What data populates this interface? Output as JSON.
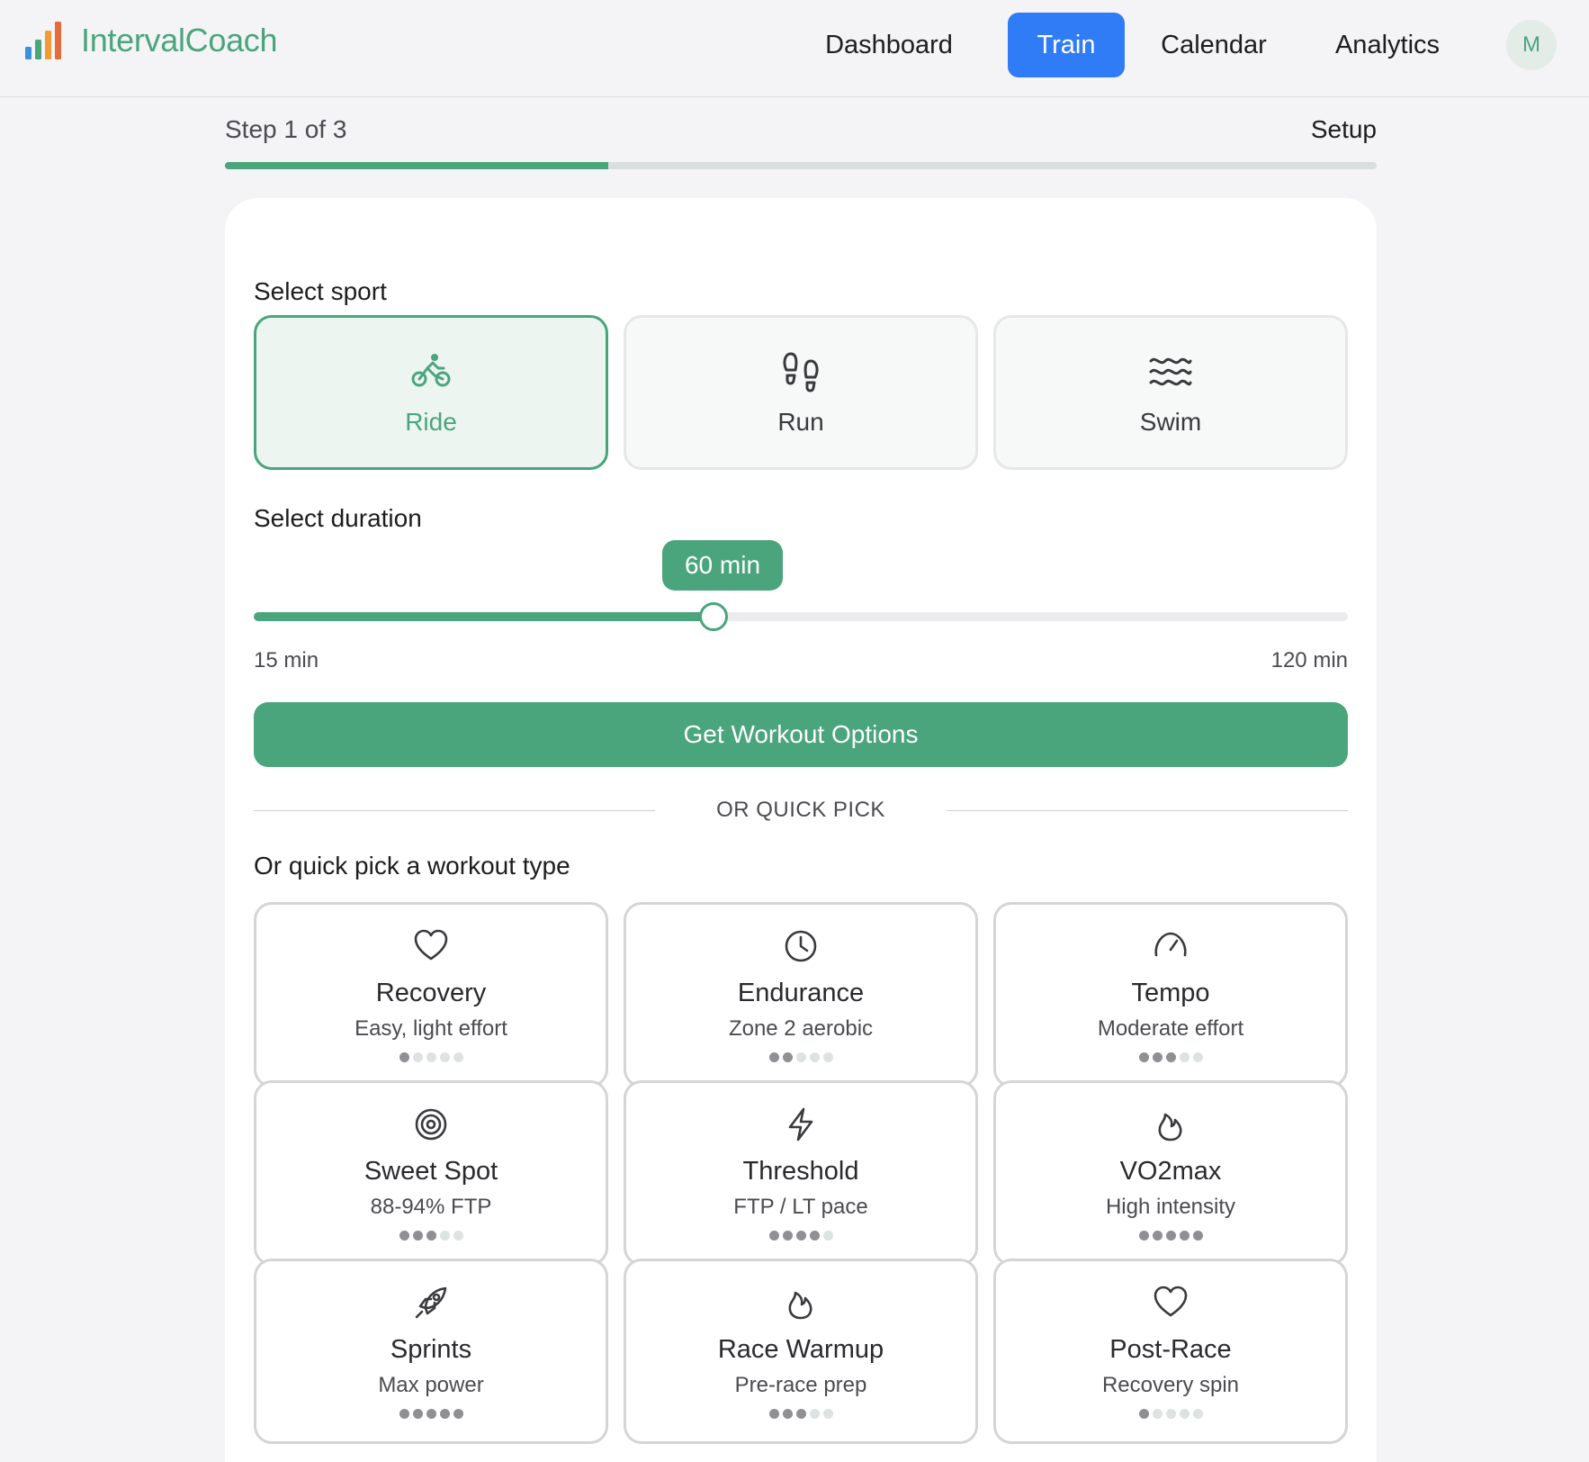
{
  "app": {
    "name": "IntervalCoach"
  },
  "nav": {
    "items": [
      {
        "label": "Dashboard",
        "active": false
      },
      {
        "label": "Train",
        "active": true
      },
      {
        "label": "Calendar",
        "active": false
      },
      {
        "label": "Analytics",
        "active": false
      }
    ],
    "avatar_initial": "M"
  },
  "progress": {
    "step_label": "Step 1 of 3",
    "step_name": "Setup",
    "fraction": 0.333
  },
  "sport_section": {
    "label": "Select sport",
    "options": [
      {
        "label": "Ride",
        "icon": "bike-icon",
        "selected": true
      },
      {
        "label": "Run",
        "icon": "footprints-icon",
        "selected": false
      },
      {
        "label": "Swim",
        "icon": "waves-icon",
        "selected": false
      }
    ]
  },
  "duration_section": {
    "label": "Select duration",
    "value_label": "60 min",
    "value": 60,
    "min": 15,
    "max": 120,
    "min_label": "15 min",
    "max_label": "120 min"
  },
  "cta": {
    "label": "Get Workout Options"
  },
  "divider": {
    "label": "OR QUICK PICK"
  },
  "quick_pick": {
    "label": "Or quick pick a workout type",
    "items": [
      {
        "title": "Recovery",
        "subtitle": "Easy, light effort",
        "intensity": 1,
        "icon": "heart-icon"
      },
      {
        "title": "Endurance",
        "subtitle": "Zone 2 aerobic",
        "intensity": 2,
        "icon": "clock-icon"
      },
      {
        "title": "Tempo",
        "subtitle": "Moderate effort",
        "intensity": 3,
        "icon": "gauge-icon"
      },
      {
        "title": "Sweet Spot",
        "subtitle": "88-94% FTP",
        "intensity": 3,
        "icon": "target-icon"
      },
      {
        "title": "Threshold",
        "subtitle": "FTP / LT pace",
        "intensity": 4,
        "icon": "lightning-icon"
      },
      {
        "title": "VO2max",
        "subtitle": "High intensity",
        "intensity": 5,
        "icon": "flame-icon"
      },
      {
        "title": "Sprints",
        "subtitle": "Max power",
        "intensity": 5,
        "icon": "rocket-icon"
      },
      {
        "title": "Race Warmup",
        "subtitle": "Pre-race prep",
        "intensity": 3,
        "icon": "flame-icon"
      },
      {
        "title": "Post-Race",
        "subtitle": "Recovery spin",
        "intensity": 1,
        "icon": "heart-icon"
      }
    ]
  },
  "colors": {
    "accent": "#4aa57d",
    "nav_active": "#2f7cf6",
    "background": "#f4f4f6"
  }
}
